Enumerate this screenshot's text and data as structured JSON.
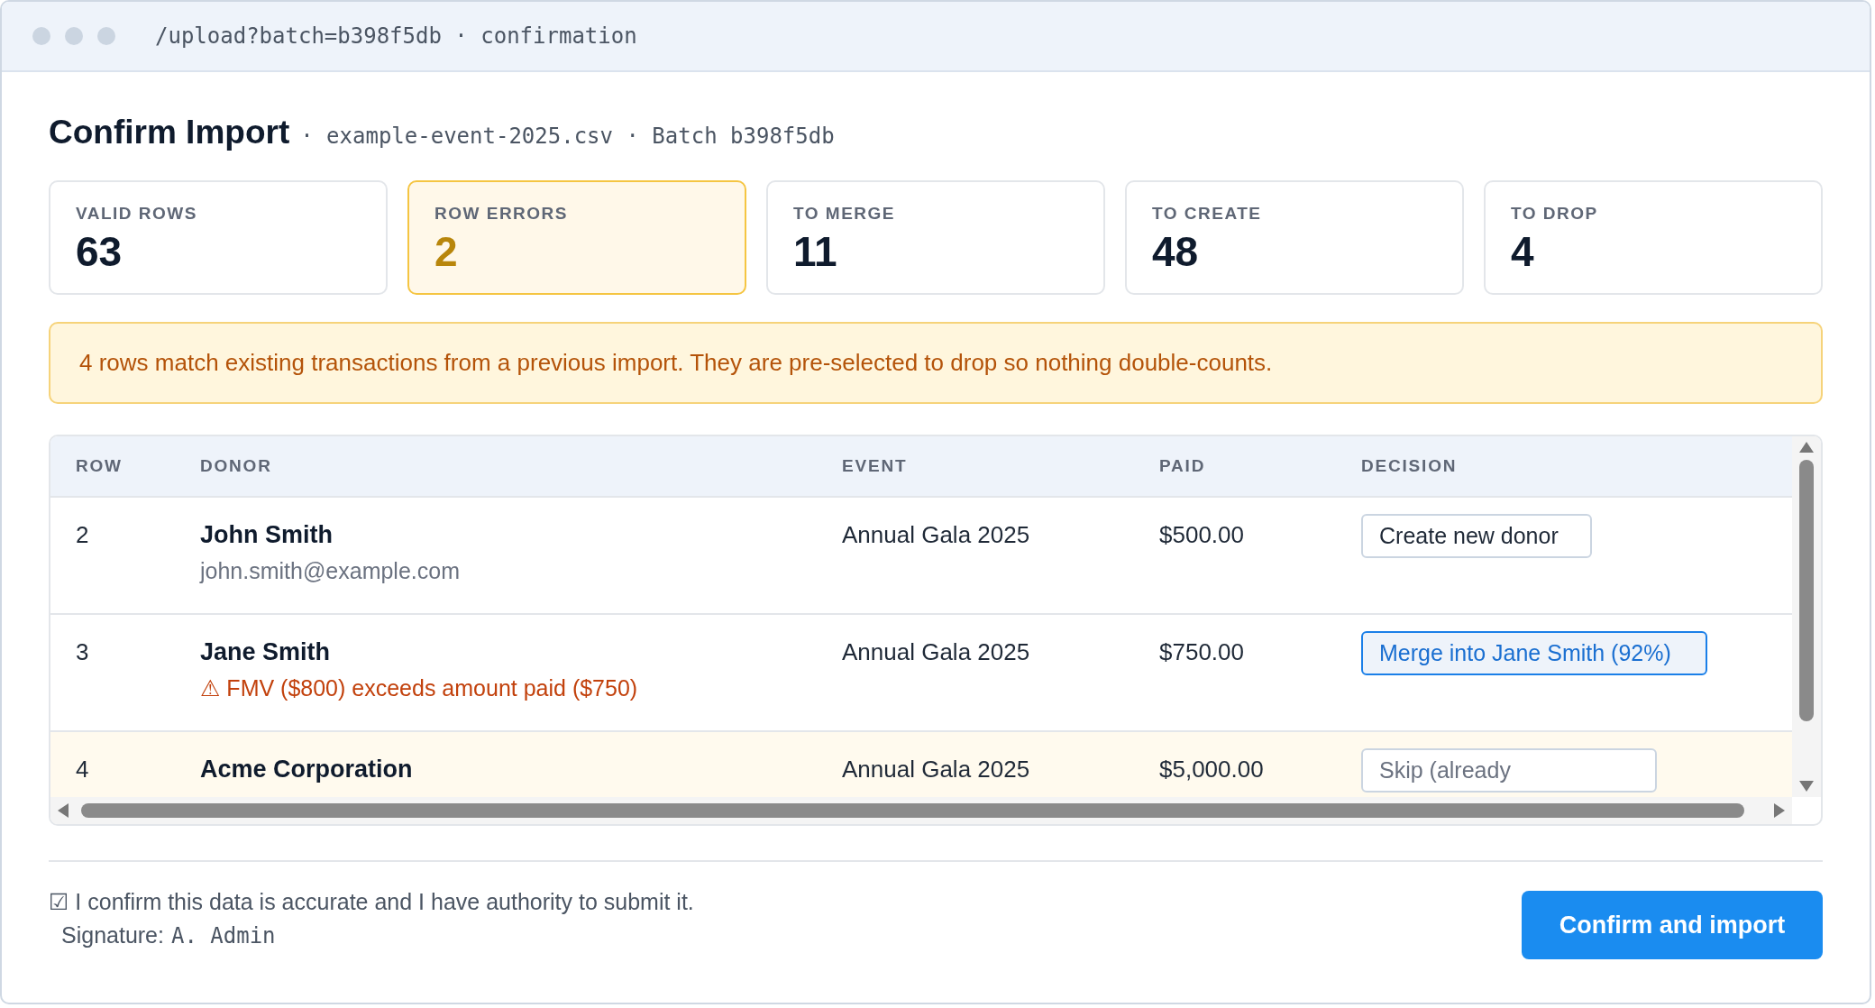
{
  "window": {
    "address": "/upload?batch=b398f5db · confirmation"
  },
  "header": {
    "title": "Confirm Import",
    "file": "· example-event-2025.csv · Batch b398f5db"
  },
  "stats": [
    {
      "label": "VALID ROWS",
      "value": "63",
      "highlight": false
    },
    {
      "label": "ROW ERRORS",
      "value": "2",
      "highlight": true
    },
    {
      "label": "TO MERGE",
      "value": "11",
      "highlight": false
    },
    {
      "label": "TO CREATE",
      "value": "48",
      "highlight": false
    },
    {
      "label": "TO DROP",
      "value": "4",
      "highlight": false
    }
  ],
  "alert": "4 rows match existing transactions from a previous import. They are pre-selected to drop so nothing double-counts.",
  "table": {
    "columns": [
      "ROW",
      "DONOR",
      "EVENT",
      "PAID",
      "DECISION"
    ],
    "rows": [
      {
        "row": "2",
        "donor": "John Smith",
        "detail": {
          "kind": "info",
          "text": "john.smith@example.com"
        },
        "event": "Annual Gala 2025",
        "paid": "$500.00",
        "decision": {
          "kind": "create",
          "label": "Create new donor"
        },
        "flagged": false
      },
      {
        "row": "3",
        "donor": "Jane Smith",
        "detail": {
          "kind": "warning",
          "text": "⚠ FMV ($800) exceeds amount paid ($750)"
        },
        "event": "Annual Gala 2025",
        "paid": "$750.00",
        "decision": {
          "kind": "merge",
          "label": "Merge into Jane Smith (92%)"
        },
        "flagged": false
      },
      {
        "row": "4",
        "donor": "Acme Corporation",
        "event": "Annual Gala 2025",
        "paid": "$5,000.00",
        "decision": {
          "kind": "skip",
          "label": "Skip (already"
        },
        "flagged": true
      }
    ]
  },
  "footer": {
    "confirmation": "☑ I confirm this data is accurate and I have authority to submit it.",
    "signature_label": "Signature:",
    "signature": "A. Admin",
    "button": "Confirm and import"
  }
}
